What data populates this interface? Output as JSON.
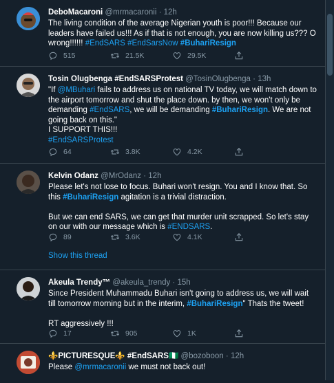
{
  "tweets": [
    {
      "name": "DeboMacaroni",
      "handle": "@mrmacaronii",
      "sep": "·",
      "time": "12h",
      "text_parts": [
        {
          "t": "The living condition of the average Nigerian youth is poor!!! Because our leaders have failed us!!! As if that is not enough, you are now killing us??? O wrong!!!!!! ",
          "c": "text"
        },
        {
          "t": "#EndSARS",
          "c": "link"
        },
        {
          "t": " ",
          "c": "text"
        },
        {
          "t": "#EndSarsNow",
          "c": "link"
        },
        {
          "t": " ",
          "c": "text"
        },
        {
          "t": "#BuhariResign",
          "c": "link bold"
        }
      ],
      "replies": "515",
      "retweets": "21.5K",
      "likes": "29.5K"
    },
    {
      "name": "Tosin Olugbenga #EndSARSProtest",
      "handle": "@TosinOlugbenga",
      "sep": "·",
      "time": "13h",
      "text_parts": [
        {
          "t": "\"If ",
          "c": "text"
        },
        {
          "t": "@MBuhari",
          "c": "link"
        },
        {
          "t": " fails to address us on national TV today, we will match down to the airport tomorrow and shut the place down. by then, we won't only be demanding ",
          "c": "text"
        },
        {
          "t": "#EndSARS",
          "c": "link"
        },
        {
          "t": ", we will be demanding ",
          "c": "text"
        },
        {
          "t": "#BuhariResign",
          "c": "link bold"
        },
        {
          "t": ". We are not going back on this.\"",
          "c": "text"
        },
        {
          "t": "\n",
          "c": "br"
        },
        {
          "t": "I SUPPORT THIS!!!",
          "c": "text"
        },
        {
          "t": "\n",
          "c": "br"
        },
        {
          "t": " #EndSARSProtest",
          "c": "link"
        }
      ],
      "replies": "64",
      "retweets": "3.8K",
      "likes": "4.2K"
    },
    {
      "name": "Kelvin Odanz",
      "handle": "@MrOdanz",
      "sep": "·",
      "time": "12h",
      "text_parts": [
        {
          "t": "Please let's not lose to focus. Buhari won't resign. You and I know that. So this ",
          "c": "text"
        },
        {
          "t": "#BuhariResign",
          "c": "link bold"
        },
        {
          "t": " agitation is a trivial distraction.",
          "c": "text"
        },
        {
          "t": "\n",
          "c": "br2"
        },
        {
          "t": "But we can end SARS, we can get that murder unit scrapped. So let's stay on our with our message which is ",
          "c": "text"
        },
        {
          "t": "#ENDSARS",
          "c": "link"
        },
        {
          "t": ".",
          "c": "text"
        }
      ],
      "replies": "89",
      "retweets": "3.6K",
      "likes": "4.1K",
      "show_thread": "Show this thread"
    },
    {
      "name": "Akeula Trendy™",
      "handle": "@akeula_trendy",
      "sep": "·",
      "time": "15h",
      "text_parts": [
        {
          "t": "Since President Muhammadu Buhari isn't going to address us, we will wait till tomorrow morning but in the interim, ",
          "c": "text"
        },
        {
          "t": "#BuhariResign",
          "c": "link bold"
        },
        {
          "t": "\" Thats the tweet!",
          "c": "text"
        },
        {
          "t": "\n",
          "c": "br2"
        },
        {
          "t": "RT aggressively !!!",
          "c": "text"
        }
      ],
      "replies": "17",
      "retweets": "905",
      "likes": "1K"
    },
    {
      "name": "⚜️PICTURESQUE⚜️ #EndSARS🇳🇬",
      "handle": "@bozoboon",
      "sep": "·",
      "time": "12h",
      "text_parts": [
        {
          "t": "Please ",
          "c": "text"
        },
        {
          "t": "@mrmacaronii",
          "c": "link"
        },
        {
          "t": " we must not back out!",
          "c": "text"
        }
      ]
    }
  ],
  "colors": {
    "background": "#15202b",
    "link": "#1da1f2",
    "muted": "#8899a6",
    "border": "#38444d"
  }
}
